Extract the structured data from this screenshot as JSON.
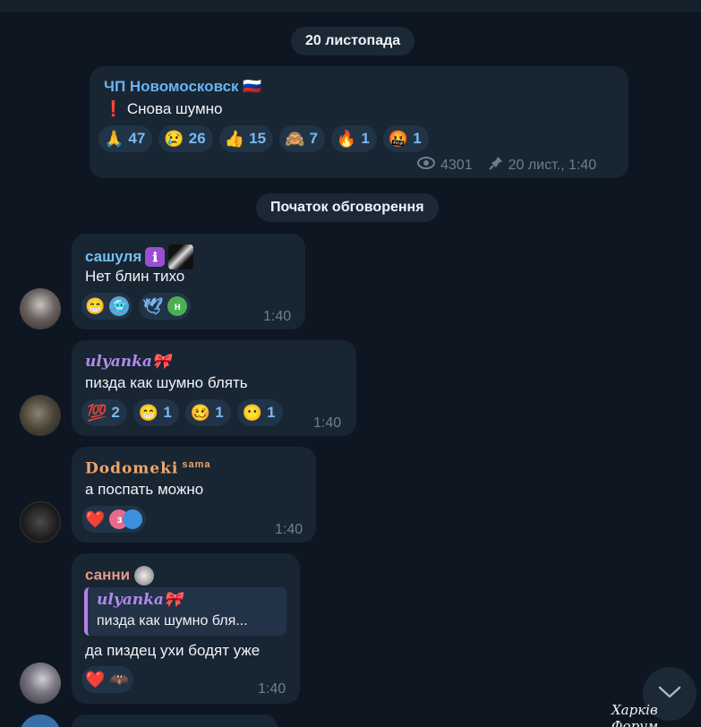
{
  "date_separator": "20 листопада",
  "channel_post": {
    "sender": "ЧП Новомосковск 🇷🇺",
    "text": "❗ Снова шумно",
    "reactions": [
      {
        "emoji": "🙏",
        "count": "47"
      },
      {
        "emoji": "😢",
        "count": "26"
      },
      {
        "emoji": "👍",
        "count": "15"
      },
      {
        "emoji": "🙈",
        "count": "7"
      },
      {
        "emoji": "🔥",
        "count": "1"
      },
      {
        "emoji": "🤬",
        "count": "1"
      }
    ],
    "views": "4301",
    "meta": "20 лист., 1:40"
  },
  "discussion_separator": "Початок обговорення",
  "messages": [
    {
      "sender": "сашуля",
      "sender_color": "#72c1f5",
      "text": "Нет блин тихо",
      "time": "1:40",
      "reactions": [
        "😁",
        "🥶",
        "🕊",
        "н"
      ]
    },
    {
      "sender": "ulyanka🎀",
      "sender_color": "#b08ae8",
      "text": "пизда как шумно блять",
      "time": "1:40",
      "reactions": [
        {
          "emoji": "💯",
          "count": "2"
        },
        {
          "emoji": "😁",
          "count": "1"
        },
        {
          "emoji": "🥴",
          "count": "1"
        },
        {
          "emoji": "😶",
          "count": "1"
        }
      ]
    },
    {
      "sender": "Dodomeki",
      "sender_suffix": "sama",
      "sender_color": "#f0a66b",
      "text": "а поспать можно",
      "time": "1:40",
      "reactions": [
        "❤️",
        "з"
      ]
    },
    {
      "sender": "санни",
      "sender_color": "#e79a86",
      "reply_sender": "ulyanka🎀",
      "reply_text": "пизда как шумно бля...",
      "text": "да пиздец ухи бодят уже",
      "time": "1:40",
      "reactions": [
        "❤️",
        "🦇"
      ]
    }
  ],
  "watermark": "Харків Форум",
  "scroll_down_icon": "chevron-down-icon",
  "accent_color": "#79b8f0"
}
